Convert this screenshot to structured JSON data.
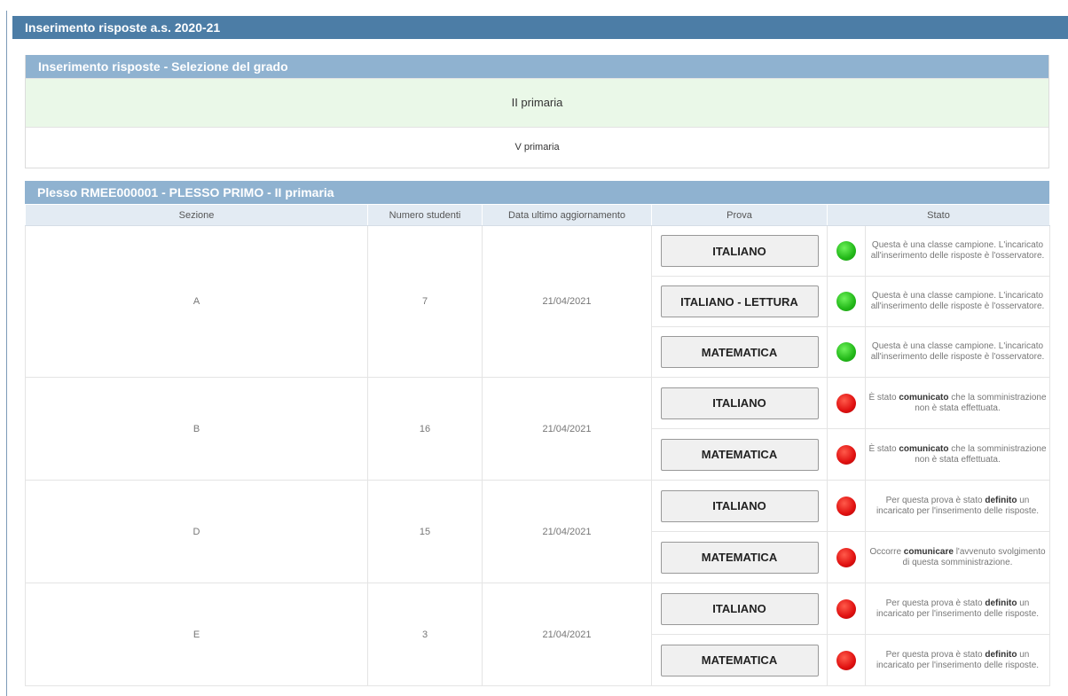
{
  "page_title": "Inserimento risposte a.s. 2020-21",
  "grade_panel": {
    "title": "Inserimento risposte - Selezione del grado",
    "options": [
      {
        "label": "II primaria",
        "selected": true
      },
      {
        "label": "V primaria",
        "selected": false
      }
    ]
  },
  "plesso_panel": {
    "title": "Plesso RMEE000001 - PLESSO PRIMO - II primaria",
    "columns": {
      "sezione": "Sezione",
      "numero_studenti": "Numero studenti",
      "data": "Data ultimo aggiornamento",
      "prova": "Prova",
      "stato": "Stato"
    },
    "sections": [
      {
        "sezione": "A",
        "numero_studenti": "7",
        "data": "21/04/2021",
        "prove": [
          {
            "label": "ITALIANO",
            "status": "green",
            "desc_parts": [
              "Questa è una classe campione. L'incaricato all'inserimento delle risposte è l'osservatore.",
              "",
              ""
            ]
          },
          {
            "label": "ITALIANO - LETTURA",
            "status": "green",
            "desc_parts": [
              "Questa è una classe campione. L'incaricato all'inserimento delle risposte è l'osservatore.",
              "",
              ""
            ]
          },
          {
            "label": "MATEMATICA",
            "status": "green",
            "desc_parts": [
              "Questa è una classe campione. L'incaricato all'inserimento delle risposte è l'osservatore.",
              "",
              ""
            ]
          }
        ]
      },
      {
        "sezione": "B",
        "numero_studenti": "16",
        "data": "21/04/2021",
        "prove": [
          {
            "label": "ITALIANO",
            "status": "red",
            "desc_parts": [
              "È stato ",
              "comunicato",
              " che la somministrazione non è stata effettuata."
            ]
          },
          {
            "label": "MATEMATICA",
            "status": "red",
            "desc_parts": [
              "È stato ",
              "comunicato",
              " che la somministrazione non è stata effettuata."
            ]
          }
        ]
      },
      {
        "sezione": "D",
        "numero_studenti": "15",
        "data": "21/04/2021",
        "prove": [
          {
            "label": "ITALIANO",
            "status": "red",
            "desc_parts": [
              "Per questa prova è stato ",
              "definito",
              " un incaricato per l'inserimento delle risposte."
            ]
          },
          {
            "label": "MATEMATICA",
            "status": "red",
            "desc_parts": [
              "Occorre ",
              "comunicare",
              " l'avvenuto svolgimento di questa somministrazione."
            ]
          }
        ]
      },
      {
        "sezione": "E",
        "numero_studenti": "3",
        "data": "21/04/2021",
        "prove": [
          {
            "label": "ITALIANO",
            "status": "red",
            "desc_parts": [
              "Per questa prova è stato ",
              "definito",
              " un incaricato per l'inserimento delle risposte."
            ]
          },
          {
            "label": "MATEMATICA",
            "status": "red",
            "desc_parts": [
              "Per questa prova è stato ",
              "definito",
              " un incaricato per l'inserimento delle risposte."
            ]
          }
        ]
      }
    ]
  },
  "colors": {
    "titlebar": "#4c7da6",
    "panel_header": "#8fb2d0",
    "selected_row": "#eaf8e8",
    "status_green": "#22b818",
    "status_red": "#e01010"
  }
}
